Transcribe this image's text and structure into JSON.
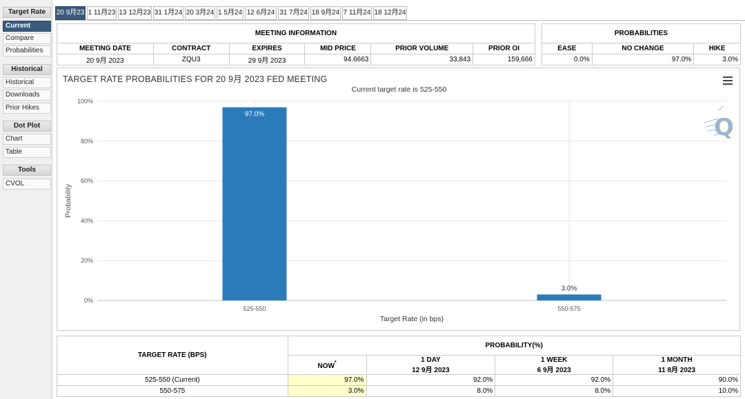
{
  "sidebar": {
    "sections": [
      {
        "header": "Target Rate",
        "items": [
          "Current",
          "Compare",
          "Probabilities"
        ]
      },
      {
        "header": "Historical",
        "items": [
          "Historical",
          "Downloads",
          "Prior Hikes"
        ]
      },
      {
        "header": "Dot Plot",
        "items": [
          "Chart",
          "Table"
        ]
      },
      {
        "header": "Tools",
        "items": [
          "CVOL"
        ]
      }
    ],
    "active_item": "Current"
  },
  "tabs": [
    "20 9月23",
    "1 11月23",
    "13 12月23",
    "31 1月24",
    "20 3月24",
    "1 5月24",
    "12 6月24",
    "31 7月24",
    "18 9月24",
    "7 11月24",
    "18 12月24"
  ],
  "meeting_info": {
    "title": "MEETING INFORMATION",
    "headers": [
      "MEETING DATE",
      "CONTRACT",
      "EXPIRES",
      "MID PRICE",
      "PRIOR VOLUME",
      "PRIOR OI"
    ],
    "values": [
      "20 9月 2023",
      "ZQU3",
      "29 9月 2023",
      "94.6663",
      "33,843",
      "159,666"
    ]
  },
  "probabilities": {
    "title": "PROBABILITIES",
    "headers": [
      "EASE",
      "NO CHANGE",
      "HIKE"
    ],
    "values": [
      "0.0%",
      "97.0%",
      "3.0%"
    ]
  },
  "chart": {
    "title": "TARGET RATE PROBABILITIES FOR 20 9月 2023 FED MEETING",
    "subtitle": "Current target rate is 525-550",
    "logo": "Q",
    "bar_color": "#2b7bba"
  },
  "chart_data": {
    "type": "bar",
    "categories": [
      "525-550",
      "550-575"
    ],
    "values": [
      97.0,
      3.0
    ],
    "data_labels": [
      "97.0%",
      "3.0%"
    ],
    "xlabel": "Target Rate (in bps)",
    "ylabel": "Probability",
    "ylim": [
      0,
      100
    ],
    "yticks": [
      "0%",
      "20%",
      "40%",
      "60%",
      "80%",
      "100%"
    ],
    "grid": true
  },
  "prob_table": {
    "col_target": "TARGET RATE (BPS)",
    "col_prob": "PROBABILITY(%)",
    "subcols": [
      {
        "label": "NOW",
        "date": "",
        "marker": "*"
      },
      {
        "label": "1 DAY",
        "date": "12 9月 2023"
      },
      {
        "label": "1 WEEK",
        "date": "6 9月 2023"
      },
      {
        "label": "1 MONTH",
        "date": "11 8月 2023"
      }
    ],
    "rows": [
      {
        "rate": "525-550 (Current)",
        "values": [
          "97.0%",
          "92.0%",
          "92.0%",
          "90.0%"
        ]
      },
      {
        "rate": "550-575",
        "values": [
          "3.0%",
          "8.0%",
          "8.0%",
          "10.0%"
        ]
      }
    ]
  }
}
